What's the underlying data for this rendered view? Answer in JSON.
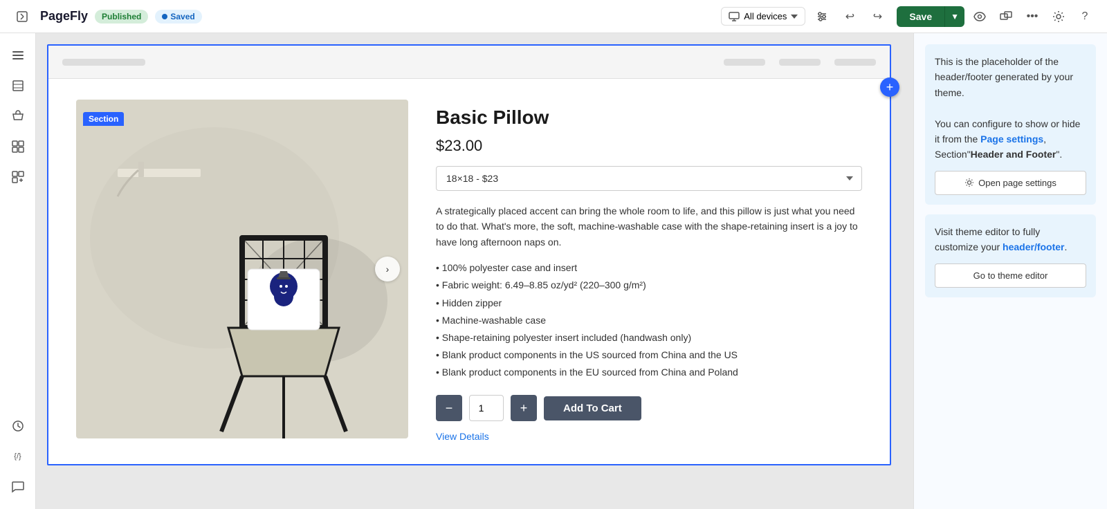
{
  "app": {
    "logo": "PageFly",
    "published_label": "Published",
    "saved_label": "Saved",
    "device_selector": "All devices",
    "save_button": "Save",
    "more_label": "..."
  },
  "sidebar": {
    "icons": [
      {
        "name": "menu-icon",
        "symbol": "☰"
      },
      {
        "name": "layers-icon",
        "symbol": "◫"
      },
      {
        "name": "store-icon",
        "symbol": "🛍"
      },
      {
        "name": "grid-icon",
        "symbol": "⊞"
      },
      {
        "name": "add-section-icon",
        "symbol": "⊞"
      },
      {
        "name": "history-icon",
        "symbol": "🕐"
      },
      {
        "name": "code-icon",
        "symbol": "{/}"
      },
      {
        "name": "chat-icon",
        "symbol": "💬"
      }
    ]
  },
  "section": {
    "label": "Section"
  },
  "product": {
    "title": "Basic Pillow",
    "price": "$23.00",
    "variant": "18×18 - $23",
    "description": "A strategically placed accent can bring the whole room to life, and this pillow is just what you need to do that. What's more, the soft, machine-washable case with the shape-retaining insert is a joy to have long afternoon naps on.",
    "features": [
      "• 100% polyester case and insert",
      "• Fabric weight: 6.49–8.85 oz/yd² (220–300 g/m²)",
      "• Hidden zipper",
      "• Machine-washable case",
      "• Shape-retaining polyester insert included (handwash only)",
      "• Blank product components in the US sourced from China and the US",
      "• Blank product components in the EU sourced from China and Poland"
    ],
    "quantity": "1",
    "add_to_cart": "Add To Cart",
    "view_details": "View Details"
  },
  "right_panel": {
    "card1_text_1": "This is the placeholder of the header/footer generated by your theme.",
    "card1_text_2": "You can configure to show or hide it from the ",
    "card1_link1": "Page settings",
    "card1_text_3": ", Section\"",
    "card1_link2": "Header and Footer",
    "card1_text_4": "\".",
    "open_settings_label": "Open page settings",
    "card2_text_1": "Visit theme editor to fully customize your header/footer.",
    "card2_link": "header/footer",
    "go_theme_editor": "Go to theme editor"
  }
}
